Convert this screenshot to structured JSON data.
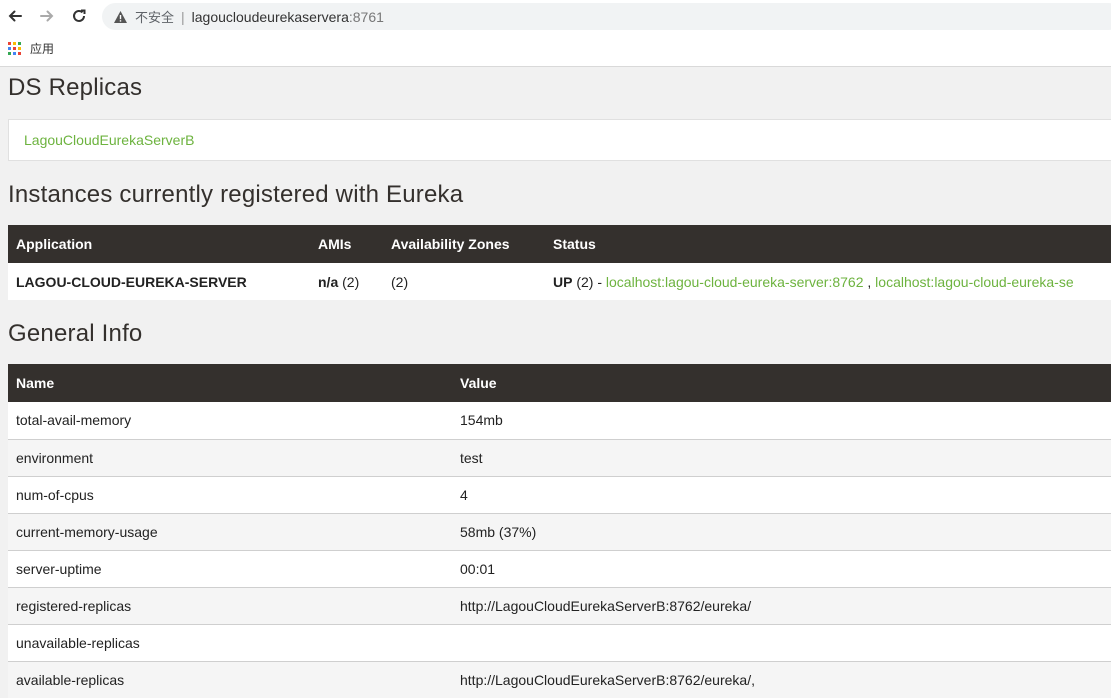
{
  "browser": {
    "security_label": "不安全",
    "url_host": "lagoucloudeurekaservera",
    "url_port": ":8761",
    "bookmark_apps_label": "应用",
    "icons": {
      "back": "arrow-left-icon",
      "forward": "arrow-right-icon",
      "reload": "reload-icon",
      "warning": "warning-triangle-icon",
      "apps": "apps-grid-icon"
    }
  },
  "colors": {
    "header_bg": "#34302d",
    "link": "#6db33f"
  },
  "ds_replicas": {
    "title": "DS Replicas",
    "replica_link": "LagouCloudEurekaServerB"
  },
  "instances": {
    "title": "Instances currently registered with Eureka",
    "headers": [
      "Application",
      "AMIs",
      "Availability Zones",
      "Status"
    ],
    "rows": [
      {
        "application": "LAGOU-CLOUD-EUREKA-SERVER",
        "amis_bold": "n/a",
        "amis_count": "(2)",
        "zones": "(2)",
        "status_bold": "UP",
        "status_count": "(2) -",
        "link1": "localhost:lagou-cloud-eureka-server:8762",
        "link_sep": ",",
        "link2": "localhost:lagou-cloud-eureka-se"
      }
    ]
  },
  "general_info": {
    "title": "General Info",
    "headers": [
      "Name",
      "Value"
    ],
    "rows": [
      {
        "name": "total-avail-memory",
        "value": "154mb"
      },
      {
        "name": "environment",
        "value": "test"
      },
      {
        "name": "num-of-cpus",
        "value": "4"
      },
      {
        "name": "current-memory-usage",
        "value": "58mb (37%)"
      },
      {
        "name": "server-uptime",
        "value": "00:01"
      },
      {
        "name": "registered-replicas",
        "value": "http://LagouCloudEurekaServerB:8762/eureka/"
      },
      {
        "name": "unavailable-replicas",
        "value": ""
      },
      {
        "name": "available-replicas",
        "value": "http://LagouCloudEurekaServerB:8762/eureka/,"
      }
    ]
  }
}
